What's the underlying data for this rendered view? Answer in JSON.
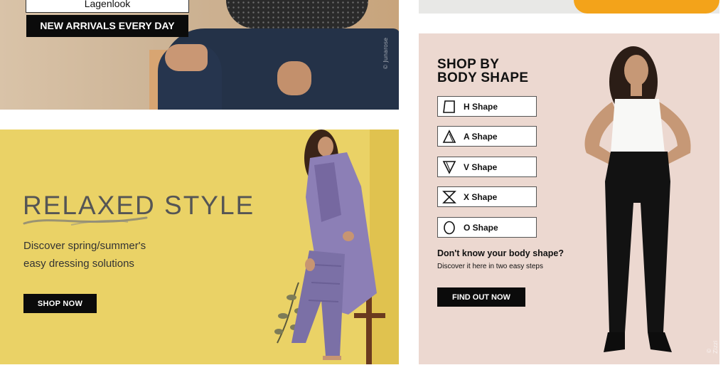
{
  "top_left_banner": {
    "brand_label": "Lagenlook",
    "new_arrivals_label": "NEW ARRIVALS EVERY DAY",
    "watermark": "© Junarose"
  },
  "relaxed_banner": {
    "title": "RELAXED STYLE",
    "subtitle_line1": "Discover spring/summer's",
    "subtitle_line2": "easy dressing solutions",
    "cta_label": "SHOP NOW"
  },
  "body_shape": {
    "heading_line1": "SHOP BY",
    "heading_line2": "BODY SHAPE",
    "shapes": [
      {
        "label": "H Shape",
        "icon": "h-shape-icon"
      },
      {
        "label": "A Shape",
        "icon": "a-shape-icon"
      },
      {
        "label": "V Shape",
        "icon": "v-shape-icon"
      },
      {
        "label": "X Shape",
        "icon": "x-shape-icon"
      },
      {
        "label": "O Shape",
        "icon": "o-shape-icon"
      }
    ],
    "question": "Don't know your body shape?",
    "question_sub": "Discover it here in two easy steps",
    "cta_label": "FIND OUT NOW",
    "copyright": "© Zizzi"
  },
  "colors": {
    "cta_background": "#0b0b0b",
    "relaxed_background": "#ead266",
    "body_shape_background": "#ecd8d0"
  }
}
